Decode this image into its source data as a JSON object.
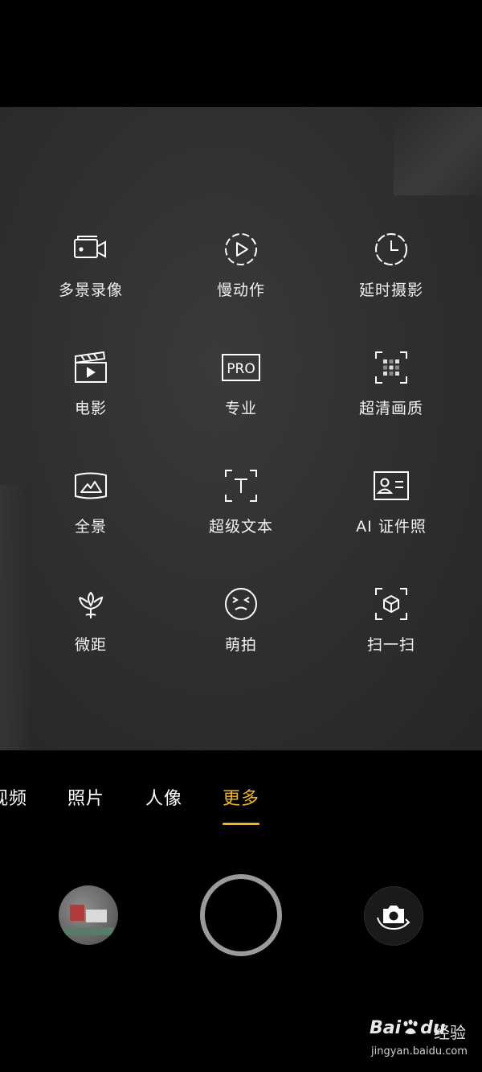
{
  "modes": [
    {
      "label": "多景录像",
      "icon": "multi-scene-video-icon"
    },
    {
      "label": "慢动作",
      "icon": "slow-motion-icon"
    },
    {
      "label": "延时摄影",
      "icon": "time-lapse-icon"
    },
    {
      "label": "电影",
      "icon": "movie-clapper-icon"
    },
    {
      "label": "专业",
      "icon": "pro-mode-icon"
    },
    {
      "label": "超清画质",
      "icon": "ultra-hd-icon"
    },
    {
      "label": "全景",
      "icon": "panorama-icon"
    },
    {
      "label": "超级文本",
      "icon": "super-text-icon"
    },
    {
      "label": "AI 证件照",
      "icon": "id-photo-icon"
    },
    {
      "label": "微距",
      "icon": "macro-flower-icon"
    },
    {
      "label": "萌拍",
      "icon": "cute-face-icon"
    },
    {
      "label": "扫一扫",
      "icon": "scan-cube-icon"
    }
  ],
  "tabs": [
    {
      "label": "视频",
      "active": false
    },
    {
      "label": "照片",
      "active": false
    },
    {
      "label": "人像",
      "active": false
    },
    {
      "label": "更多",
      "active": true
    }
  ],
  "colors": {
    "accent": "#f5b323",
    "shutter_ring": "#9a9a9a"
  },
  "watermark": {
    "brand": "Bai",
    "brand2": "du",
    "cn": "经验",
    "url": "jingyan.baidu.com"
  }
}
